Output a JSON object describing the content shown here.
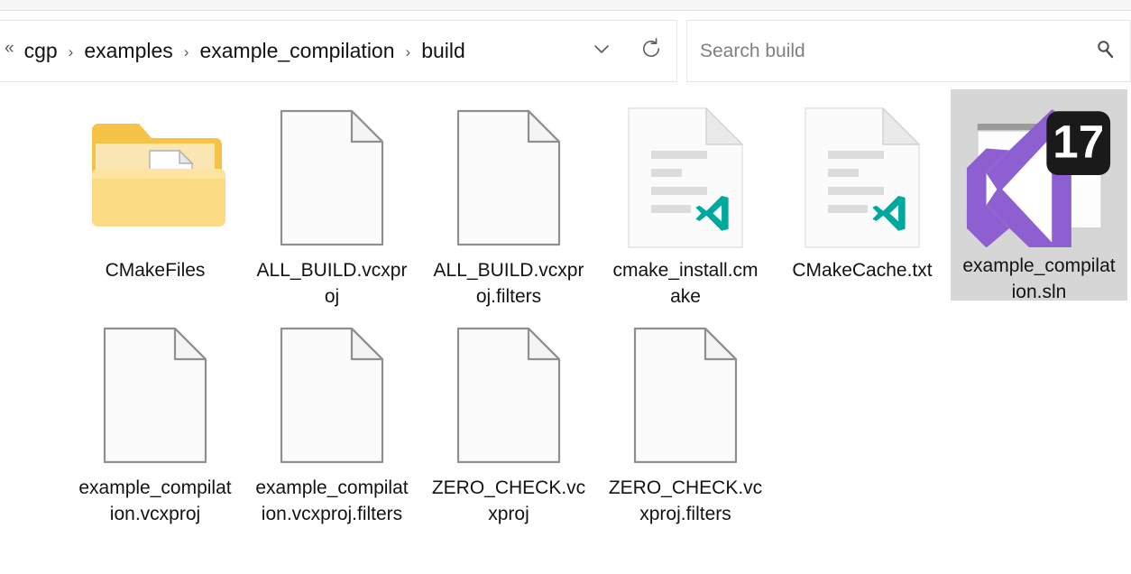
{
  "window": {
    "type": "file-explorer"
  },
  "addressbar": {
    "overflow_symbol": "«",
    "crumbs": [
      "cgp",
      "examples",
      "example_compilation",
      "build"
    ],
    "separator": "›",
    "dropdown_icon": "chevron-down-icon",
    "refresh_icon": "refresh-icon"
  },
  "search": {
    "placeholder": "Search build",
    "value": "",
    "icon": "search-icon"
  },
  "colors": {
    "folder_back": "#f5c346",
    "folder_mid": "#f8e3a8",
    "folder_front": "#fbdc85",
    "folder_edge": "#e0a81e",
    "doc_border": "#9a9a9a",
    "doc_fill": "#fafafa",
    "doc_line": "#d9d9d9",
    "vscode_teal": "#00a99d",
    "vs_purple": "#8e5fd0",
    "badge_black": "#1a1a1a",
    "selection_bg": "#d6d6d6",
    "text": "#131313"
  },
  "files": [
    {
      "name": "CMakeFiles",
      "icon": "folder-icon",
      "kind": "folder",
      "selected": false
    },
    {
      "name": "ALL_BUILD.vcxproj",
      "icon": "blank-document-icon",
      "kind": "file",
      "selected": false
    },
    {
      "name": "ALL_BUILD.vcxproj.filters",
      "icon": "blank-document-icon",
      "kind": "file",
      "selected": false
    },
    {
      "name": "cmake_install.cmake",
      "icon": "vscode-document-icon",
      "kind": "file",
      "selected": false
    },
    {
      "name": "CMakeCache.txt",
      "icon": "vscode-document-icon",
      "kind": "file",
      "selected": false
    },
    {
      "name": "example_compilation.sln",
      "icon": "visual-studio-solution-icon",
      "kind": "file",
      "selected": true,
      "badge": "17"
    },
    {
      "name": "example_compilation.vcxproj",
      "icon": "blank-document-icon",
      "kind": "file",
      "selected": false
    },
    {
      "name": "example_compilation.vcxproj.filters",
      "icon": "blank-document-icon",
      "kind": "file",
      "selected": false
    },
    {
      "name": "ZERO_CHECK.vcxproj",
      "icon": "blank-document-icon",
      "kind": "file",
      "selected": false
    },
    {
      "name": "ZERO_CHECK.vcxproj.filters",
      "icon": "blank-document-icon",
      "kind": "file",
      "selected": false
    }
  ]
}
